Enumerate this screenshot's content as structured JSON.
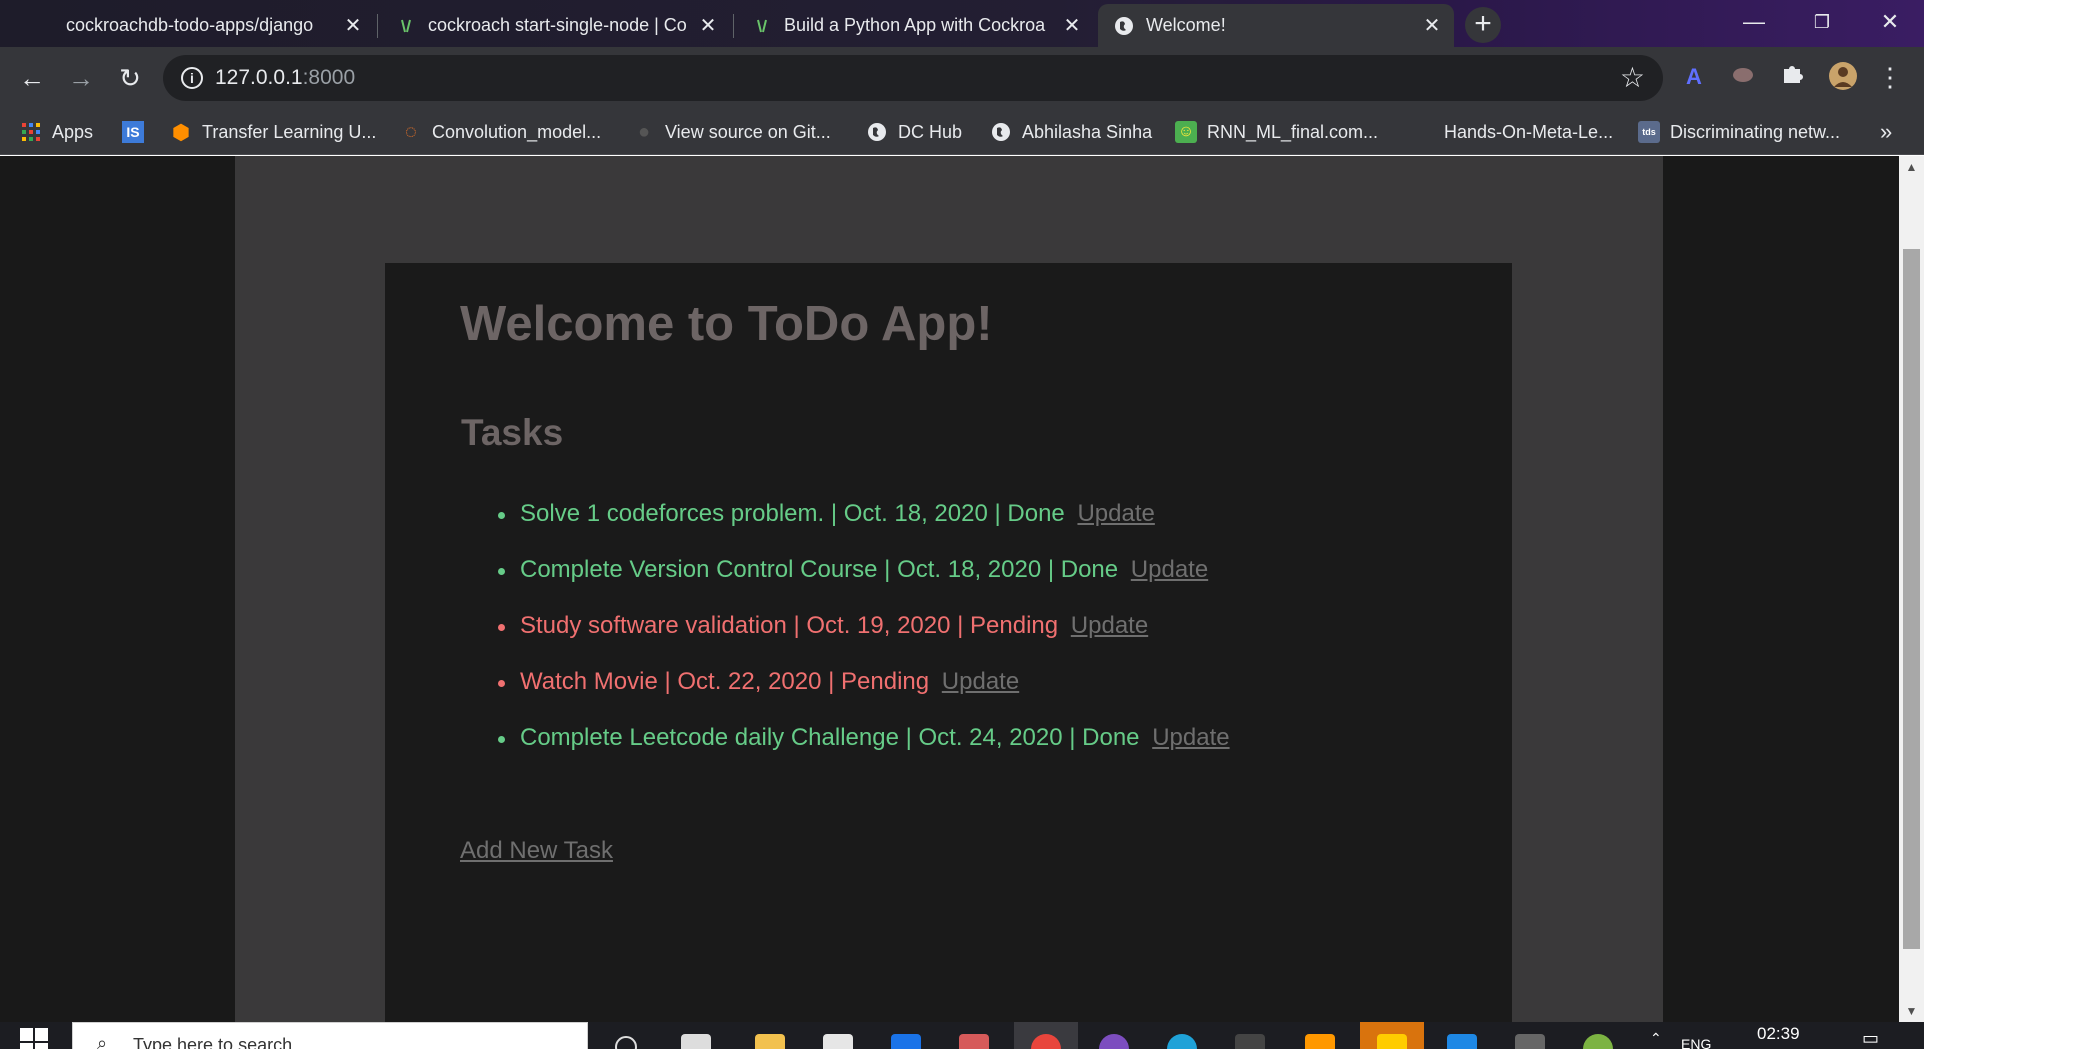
{
  "browser": {
    "tabs": [
      {
        "title": "cockroachdb-todo-apps/django",
        "active": false
      },
      {
        "title": "cockroach start-single-node | Co",
        "active": false
      },
      {
        "title": "Build a Python App with Cockroa",
        "active": false
      },
      {
        "title": "Welcome!",
        "active": true
      }
    ],
    "new_tab_label": "+",
    "url_host": "127.0.0.1",
    "url_port": ":8000"
  },
  "bookmarks": [
    {
      "label": "Apps",
      "icon": "apps-grid-icon"
    },
    {
      "label": "",
      "icon": "is-icon"
    },
    {
      "label": "Transfer Learning U...",
      "icon": "tensorflow-icon"
    },
    {
      "label": "Convolution_model...",
      "icon": "jupyter-icon"
    },
    {
      "label": "View source on Git...",
      "icon": "github-icon"
    },
    {
      "label": "DC Hub",
      "icon": "globe-icon"
    },
    {
      "label": "Abhilasha Sinha",
      "icon": "globe-icon"
    },
    {
      "label": "RNN_ML_final.com...",
      "icon": "smiley-icon"
    },
    {
      "label": "Hands-On-Meta-Le...",
      "icon": "blank-icon"
    },
    {
      "label": "Discriminating netw...",
      "icon": "tds-icon"
    }
  ],
  "bookmarks_overflow": "»",
  "page": {
    "title": "Welcome to ToDo App!",
    "tasks_heading": "Tasks",
    "tasks": [
      {
        "text": "Solve 1 codeforces problem. | Oct. 18, 2020 | Done",
        "status": "done",
        "link": "Update"
      },
      {
        "text": "Complete Version Control Course | Oct. 18, 2020 | Done",
        "status": "done",
        "link": "Update"
      },
      {
        "text": "Study software validation | Oct. 19, 2020 | Pending",
        "status": "pending",
        "link": "Update"
      },
      {
        "text": "Watch Movie | Oct. 22, 2020 | Pending",
        "status": "pending",
        "link": "Update"
      },
      {
        "text": "Complete Leetcode daily Challenge | Oct. 24, 2020 | Done",
        "status": "done",
        "link": "Update"
      }
    ],
    "add_task_label": "Add New Task"
  },
  "taskbar": {
    "search_placeholder": "Type here to search",
    "lang": "ENG",
    "clock": "02:39"
  },
  "colors": {
    "done": "#66cc88",
    "pending": "#f07070",
    "heading": "#6d6565",
    "link": "#6f6f6f"
  }
}
